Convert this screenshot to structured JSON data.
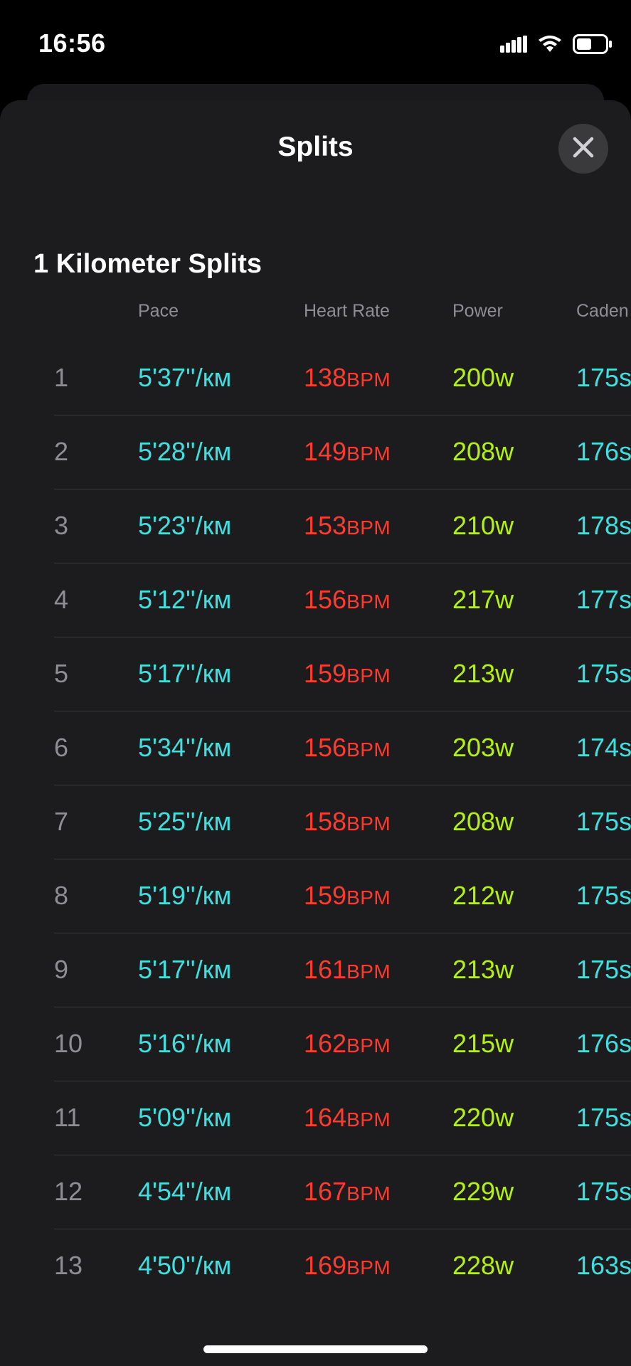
{
  "status_bar": {
    "time": "16:56",
    "icons": [
      "signal-icon",
      "wifi-icon",
      "battery-icon"
    ]
  },
  "sheet": {
    "title": "Splits",
    "close_icon": "close-icon",
    "section_title": "1 Kilometer Splits"
  },
  "table": {
    "headers": {
      "pace": "Pace",
      "heart_rate": "Heart Rate",
      "power": "Power",
      "cadence": "Caden"
    },
    "units": {
      "pace": "/км",
      "heart_rate": "BPM",
      "power": "w",
      "cadence": "s"
    },
    "rows": [
      {
        "index": "1",
        "pace": "5'37''",
        "heart_rate": "138",
        "power": "200",
        "cadence": "175"
      },
      {
        "index": "2",
        "pace": "5'28''",
        "heart_rate": "149",
        "power": "208",
        "cadence": "176"
      },
      {
        "index": "3",
        "pace": "5'23''",
        "heart_rate": "153",
        "power": "210",
        "cadence": "178"
      },
      {
        "index": "4",
        "pace": "5'12''",
        "heart_rate": "156",
        "power": "217",
        "cadence": "177"
      },
      {
        "index": "5",
        "pace": "5'17''",
        "heart_rate": "159",
        "power": "213",
        "cadence": "175"
      },
      {
        "index": "6",
        "pace": "5'34''",
        "heart_rate": "156",
        "power": "203",
        "cadence": "174"
      },
      {
        "index": "7",
        "pace": "5'25''",
        "heart_rate": "158",
        "power": "208",
        "cadence": "175"
      },
      {
        "index": "8",
        "pace": "5'19''",
        "heart_rate": "159",
        "power": "212",
        "cadence": "175"
      },
      {
        "index": "9",
        "pace": "5'17''",
        "heart_rate": "161",
        "power": "213",
        "cadence": "175"
      },
      {
        "index": "10",
        "pace": "5'16''",
        "heart_rate": "162",
        "power": "215",
        "cadence": "176"
      },
      {
        "index": "11",
        "pace": "5'09''",
        "heart_rate": "164",
        "power": "220",
        "cadence": "175"
      },
      {
        "index": "12",
        "pace": "4'54''",
        "heart_rate": "167",
        "power": "229",
        "cadence": "175"
      },
      {
        "index": "13",
        "pace": "4'50''",
        "heart_rate": "169",
        "power": "228",
        "cadence": "163"
      }
    ]
  },
  "colors": {
    "background": "#000000",
    "sheet": "#1c1c1e",
    "pace": "#40e0e0",
    "heart_rate": "#ff3b2f",
    "power": "#b4f20e",
    "cadence": "#40e0e0",
    "muted": "#8e8e93"
  }
}
